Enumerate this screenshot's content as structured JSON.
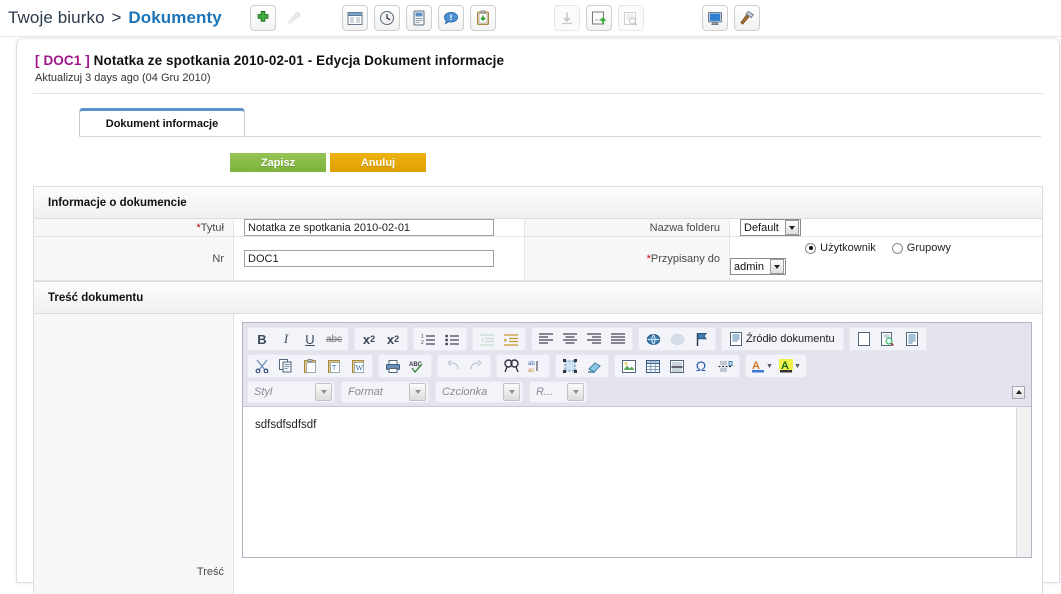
{
  "breadcrumb": {
    "home": "Twoje biurko",
    "separator": ">",
    "current": "Dokumenty"
  },
  "toolbar_icons": [
    {
      "name": "add-icon",
      "label": "Dodaj",
      "enabled": true
    },
    {
      "name": "edit-pencil-icon",
      "label": "Edytuj",
      "enabled": false
    },
    {
      "name": "window-icon",
      "label": "Okno",
      "enabled": true
    },
    {
      "name": "clock-icon",
      "label": "Historia",
      "enabled": true
    },
    {
      "name": "device-icon",
      "label": "Urzadzenie",
      "enabled": true
    },
    {
      "name": "comment-icon",
      "label": "Komentarz",
      "enabled": true
    },
    {
      "name": "clipboard-icon",
      "label": "Schowek",
      "enabled": true
    },
    {
      "name": "download-icon",
      "label": "Pobierz",
      "enabled": false
    },
    {
      "name": "upload-icon",
      "label": "Wyslij",
      "enabled": true
    },
    {
      "name": "preview-icon",
      "label": "Podglad",
      "enabled": false
    },
    {
      "name": "monitor-icon",
      "label": "Monitor",
      "enabled": true
    },
    {
      "name": "hammer-icon",
      "label": "Narzedzia",
      "enabled": true
    }
  ],
  "page": {
    "doc_code": "[ DOC1 ]",
    "title": "Notatka ze spotkania 2010-02-01 - Edycja Dokument informacje",
    "subtitle": "Aktualizuj 3 days ago (04 Gru 2010)"
  },
  "tabs": [
    {
      "label": "Dokument informacje",
      "active": true
    }
  ],
  "actions": {
    "save_label": "Zapisz",
    "cancel_label": "Anuluj"
  },
  "form": {
    "section_title": "Informacje o dokumencie",
    "title_label": "Tytuł",
    "title_required": "*",
    "title_value": "Notatka ze spotkania 2010-02-01",
    "nr_label": "Nr",
    "nr_value": "DOC1",
    "folder_label": "Nazwa folderu",
    "folder_value": "Default",
    "assigned_label": "Przypisany do",
    "assigned_required": "*",
    "radio_user": "Użytkownik",
    "radio_group": "Grupowy",
    "assigned_user": "admin"
  },
  "content_section": {
    "section_title": "Treść dokumentu",
    "field_label": "Treść",
    "body_text": "sdfsdfsdfsdf"
  },
  "editor": {
    "row1": [
      {
        "name": "bold-icon",
        "glyph": "B",
        "enabled": true
      },
      {
        "name": "italic-icon",
        "glyph": "I",
        "enabled": true
      },
      {
        "name": "underline-icon",
        "glyph": "U",
        "enabled": true
      },
      {
        "name": "strikethrough-icon",
        "glyph": "abc",
        "enabled": true
      },
      {
        "name": "subscript-icon",
        "glyph": "x2",
        "enabled": true
      },
      {
        "name": "superscript-icon",
        "glyph": "x2",
        "enabled": true
      },
      {
        "name": "ordered-list-icon",
        "glyph": "",
        "enabled": true
      },
      {
        "name": "unordered-list-icon",
        "glyph": "",
        "enabled": true
      },
      {
        "name": "outdent-icon",
        "glyph": "",
        "enabled": false
      },
      {
        "name": "indent-icon",
        "glyph": "",
        "enabled": true
      },
      {
        "name": "align-left-icon",
        "glyph": "",
        "enabled": true
      },
      {
        "name": "align-center-icon",
        "glyph": "",
        "enabled": true
      },
      {
        "name": "align-right-icon",
        "glyph": "",
        "enabled": true
      },
      {
        "name": "align-justify-icon",
        "glyph": "",
        "enabled": true
      },
      {
        "name": "link-icon",
        "glyph": "",
        "enabled": true
      },
      {
        "name": "unlink-icon",
        "glyph": "",
        "enabled": false
      },
      {
        "name": "anchor-flag-icon",
        "glyph": "",
        "enabled": true
      },
      {
        "name": "page-blank-icon",
        "glyph": "",
        "enabled": true
      },
      {
        "name": "preview-page-icon",
        "glyph": "",
        "enabled": true
      },
      {
        "name": "templates-icon",
        "glyph": "",
        "enabled": true
      }
    ],
    "source_button": "Źródło dokumentu",
    "row2": [
      {
        "name": "cut-scissors-icon",
        "enabled": true
      },
      {
        "name": "copy-icon",
        "enabled": true
      },
      {
        "name": "paste-icon",
        "enabled": true
      },
      {
        "name": "paste-text-icon",
        "enabled": true
      },
      {
        "name": "paste-word-icon",
        "enabled": true
      },
      {
        "name": "print-icon",
        "enabled": true
      },
      {
        "name": "spellcheck-icon",
        "enabled": true
      },
      {
        "name": "undo-icon",
        "enabled": false
      },
      {
        "name": "redo-icon",
        "enabled": false
      },
      {
        "name": "find-icon",
        "enabled": true
      },
      {
        "name": "replace-icon",
        "enabled": true
      },
      {
        "name": "select-all-icon",
        "enabled": true
      },
      {
        "name": "remove-format-icon",
        "enabled": true
      },
      {
        "name": "image-icon",
        "enabled": true
      },
      {
        "name": "table-icon",
        "enabled": true
      },
      {
        "name": "horizontal-rule-icon",
        "enabled": true
      },
      {
        "name": "special-char-icon",
        "glyph": "Ω",
        "enabled": true
      },
      {
        "name": "page-break-icon",
        "enabled": true
      },
      {
        "name": "text-color-icon",
        "glyph": "A",
        "enabled": true
      },
      {
        "name": "bg-color-icon",
        "glyph": "A",
        "enabled": true
      }
    ],
    "dropdowns": [
      {
        "name": "style-select",
        "label": "Styl"
      },
      {
        "name": "format-select",
        "label": "Format"
      },
      {
        "name": "font-select",
        "label": "Czcionka"
      },
      {
        "name": "size-select",
        "label": "R..."
      }
    ]
  },
  "colors": {
    "accent_blue": "#1a74b8",
    "tab_top": "#5b93c8",
    "doc_code_purple": "#a0148c",
    "save_green": "#7db33d",
    "cancel_orange": "#eeb211",
    "required_red": "#cc0000",
    "toolbar_bg": "#e3e3ee"
  }
}
